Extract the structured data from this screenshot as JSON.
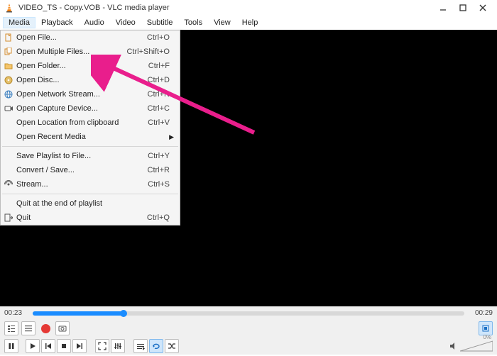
{
  "title": "VIDEO_TS - Copy.VOB - VLC media player",
  "menubar": [
    "Media",
    "Playback",
    "Audio",
    "Video",
    "Subtitle",
    "Tools",
    "View",
    "Help"
  ],
  "menu_active_index": 0,
  "dropdown": {
    "groups": [
      [
        {
          "icon": "file",
          "label": "Open File...",
          "shortcut": "Ctrl+O"
        },
        {
          "icon": "files",
          "label": "Open Multiple Files...",
          "shortcut": "Ctrl+Shift+O"
        },
        {
          "icon": "folder",
          "label": "Open Folder...",
          "shortcut": "Ctrl+F"
        },
        {
          "icon": "disc",
          "label": "Open Disc...",
          "shortcut": "Ctrl+D"
        },
        {
          "icon": "network",
          "label": "Open Network Stream...",
          "shortcut": "Ctrl+N"
        },
        {
          "icon": "capture",
          "label": "Open Capture Device...",
          "shortcut": "Ctrl+C"
        },
        {
          "icon": "",
          "label": "Open Location from clipboard",
          "shortcut": "Ctrl+V"
        },
        {
          "icon": "",
          "label": "Open Recent Media",
          "shortcut": "",
          "submenu": true
        }
      ],
      [
        {
          "icon": "",
          "label": "Save Playlist to File...",
          "shortcut": "Ctrl+Y"
        },
        {
          "icon": "",
          "label": "Convert / Save...",
          "shortcut": "Ctrl+R"
        },
        {
          "icon": "stream",
          "label": "Stream...",
          "shortcut": "Ctrl+S"
        }
      ],
      [
        {
          "icon": "",
          "label": "Quit at the end of playlist",
          "shortcut": ""
        },
        {
          "icon": "quit",
          "label": "Quit",
          "shortcut": "Ctrl+Q"
        }
      ]
    ]
  },
  "playback": {
    "current": "00:23",
    "total": "00:29",
    "progress_pct": 21
  },
  "volume": {
    "pct_label": "0%"
  },
  "controls1_icons": [
    "playlist",
    "list",
    "record",
    "snapshot"
  ],
  "controls2": {
    "playback_icons": [
      "pause",
      "play",
      "prev",
      "stop",
      "next"
    ],
    "view_icons": [
      "fullscreen",
      "equalizer"
    ],
    "loop_icons": [
      "loop-list",
      "loop-one",
      "shuffle"
    ]
  }
}
